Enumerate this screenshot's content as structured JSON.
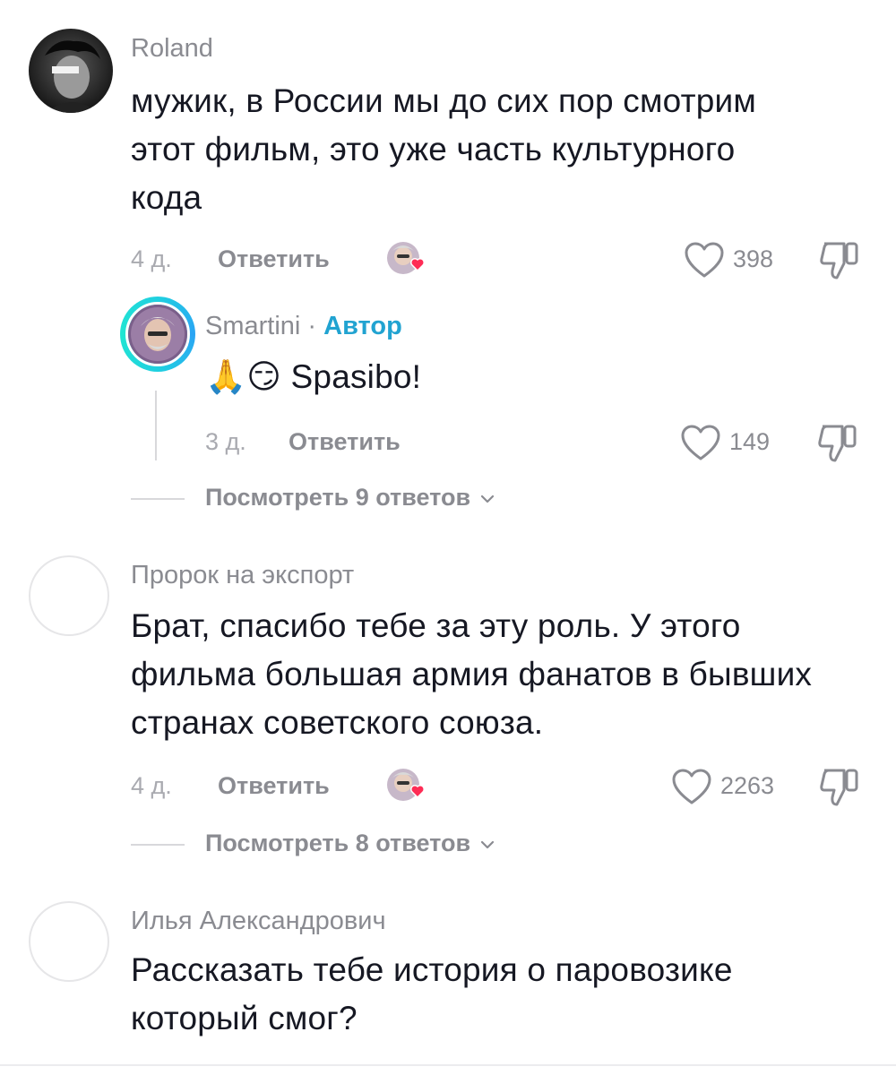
{
  "comments": [
    {
      "username": "Roland",
      "text_lines": [
        "мужик, в России мы до сих пор смотрим",
        "этот фильм, это уже часть культурного",
        "кода"
      ],
      "time": "4 д.",
      "reply_label": "Ответить",
      "likes": "398",
      "creator_liked": true,
      "view_replies": "Посмотреть 9 ответов",
      "reply": {
        "username": "Smartini",
        "separator": "·",
        "badge": "Автор",
        "text_emoji": "🙏😏",
        "text": "Spasibo!",
        "time": "3 д.",
        "reply_label": "Ответить",
        "likes": "149"
      }
    },
    {
      "username": "Пророк на экспорт",
      "text_lines": [
        "Брат, спасибо тебе за эту роль. У этого",
        "фильма большая армия фанатов в бывших",
        "странах советского союза."
      ],
      "time": "4 д.",
      "reply_label": "Ответить",
      "likes": "2263",
      "creator_liked": true,
      "view_replies": "Посмотреть 8 ответов"
    },
    {
      "username": "Илья Александрович",
      "text_lines": [
        "Рассказать тебе история о паровозике",
        "который смог?"
      ]
    }
  ],
  "icons": {
    "heart": "heart-outline-icon",
    "dislike": "thumbs-down-icon",
    "chevron": "chevron-down-icon"
  },
  "colors": {
    "text": "#161823",
    "muted": "#8a8b91",
    "author_badge": "#21a3d1",
    "creator_heart": "#fe2c55"
  }
}
